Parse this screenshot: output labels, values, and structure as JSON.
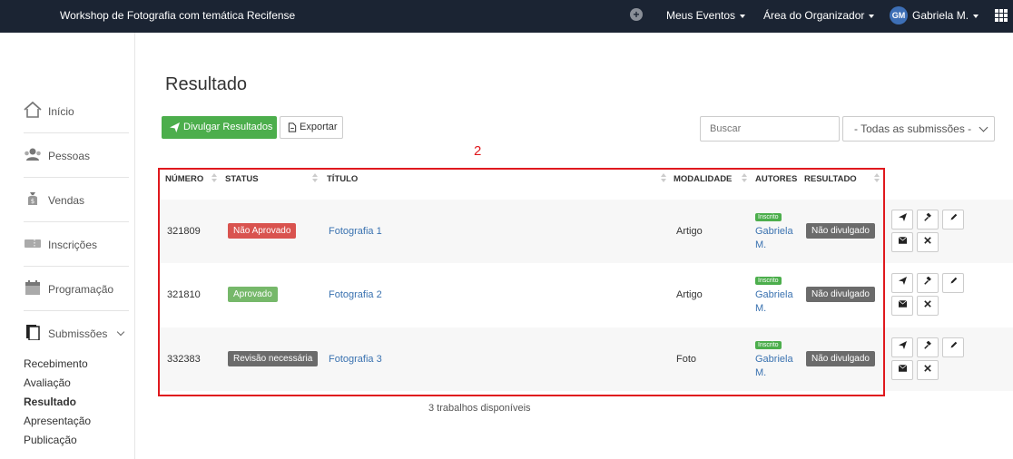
{
  "topbar": {
    "event_title": "Workshop de Fotografia com temática Recifense",
    "menu_events": "Meus Eventos",
    "menu_organizer": "Área do Organizador",
    "avatar_initials": "GM",
    "user_name": "Gabriela M."
  },
  "sidebar": {
    "items": [
      {
        "label": "Início",
        "icon": "home-icon"
      },
      {
        "label": "Pessoas",
        "icon": "users-icon"
      },
      {
        "label": "Vendas",
        "icon": "money-bag-icon"
      },
      {
        "label": "Inscrições",
        "icon": "ticket-icon"
      },
      {
        "label": "Programação",
        "icon": "calendar-icon"
      },
      {
        "label": "Submissões",
        "icon": "document-icon"
      }
    ],
    "subitems": [
      "Recebimento",
      "Avaliação",
      "Resultado",
      "Apresentação",
      "Publicação"
    ]
  },
  "page": {
    "title": "Resultado",
    "publish_button": "Divulgar Resultados",
    "export_button": "Exportar",
    "search_placeholder": "Buscar",
    "filter_value": "- Todas as submissões -",
    "annotation": "2",
    "footer_count": "3 trabalhos disponíveis"
  },
  "table": {
    "headers": {
      "numero": "NÚMERO",
      "status": "STATUS",
      "titulo": "TÍTULO",
      "modalidade": "MODALIDADE",
      "autores": "AUTORES",
      "resultado": "RESULTADO"
    },
    "rows": [
      {
        "numero": "321809",
        "status": "Não Aprovado",
        "status_color": "#d9534f",
        "titulo": "Fotografia 1",
        "modalidade": "Artigo",
        "author_badge": "Inscrito",
        "author_first": "Gabriela",
        "author_last": "M.",
        "resultado": "Não divulgado"
      },
      {
        "numero": "321810",
        "status": "Aprovado",
        "status_color": "#76b86a",
        "titulo": "Fotografia 2",
        "modalidade": "Artigo",
        "author_badge": "Inscrito",
        "author_first": "Gabriela",
        "author_last": "M.",
        "resultado": "Não divulgado"
      },
      {
        "numero": "332383",
        "status": "Revisão necessária",
        "status_color": "#6b6b6b",
        "titulo": "Fotografia 3",
        "modalidade": "Foto",
        "author_badge": "Inscrito",
        "author_first": "Gabriela",
        "author_last": "M.",
        "resultado": "Não divulgado"
      }
    ]
  }
}
